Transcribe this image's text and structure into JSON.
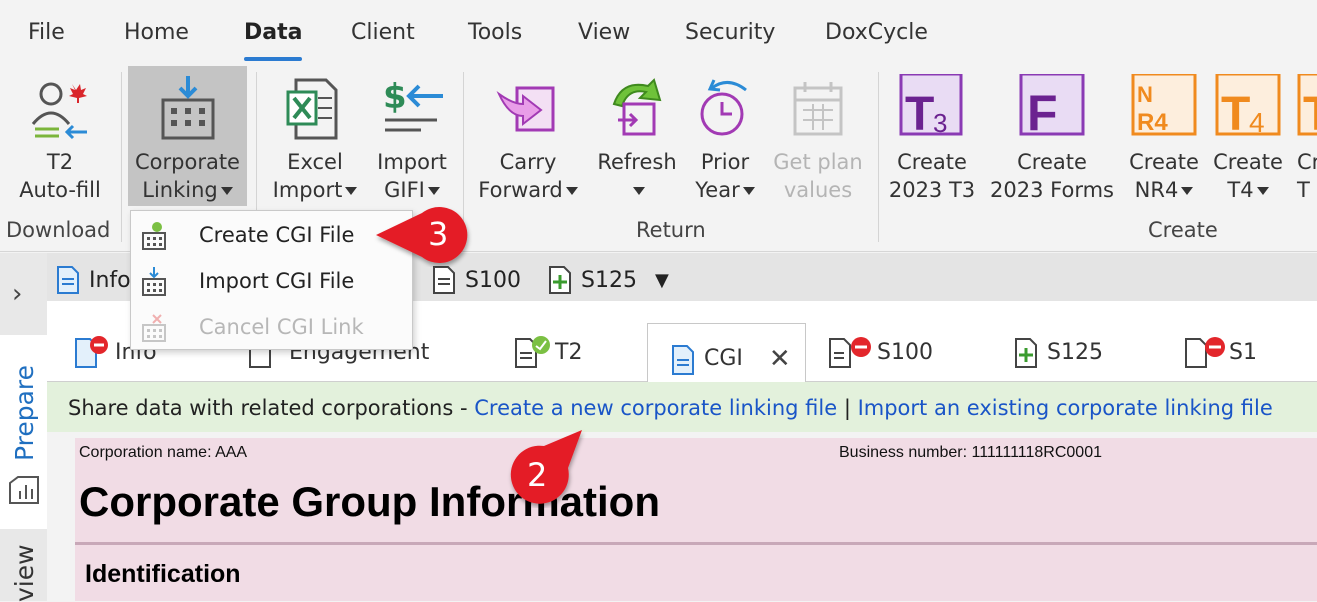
{
  "menu": {
    "tabs": [
      {
        "label": "File"
      },
      {
        "label": "Home"
      },
      {
        "label": "Data"
      },
      {
        "label": "Client"
      },
      {
        "label": "Tools"
      },
      {
        "label": "View"
      },
      {
        "label": "Security"
      },
      {
        "label": "DoxCycle"
      }
    ],
    "active": "Data"
  },
  "ribbon": {
    "buttons": [
      {
        "line1": "T2",
        "line2": "Auto-fill",
        "icon": "t2-autofill-icon"
      },
      {
        "line1": "Corporate",
        "line2": "Linking",
        "icon": "corporate-linking-icon"
      },
      {
        "line1": "Excel",
        "line2": "Import",
        "icon": "excel-icon"
      },
      {
        "line1": "Import",
        "line2": "GIFI",
        "icon": "gifi-import-icon"
      },
      {
        "line1": "Carry",
        "line2": "Forward",
        "icon": "carry-forward-icon"
      },
      {
        "line1": "Refresh",
        "line2": "",
        "icon": "refresh-icon"
      },
      {
        "line1": "Prior",
        "line2": "Year",
        "icon": "prior-year-icon"
      },
      {
        "line1": "Get plan",
        "line2": "values",
        "icon": "calendar-icon"
      },
      {
        "line1": "Create",
        "line2": "2023 T3",
        "icon": "t3-icon"
      },
      {
        "line1": "Create",
        "line2": "2023 Forms",
        "icon": "forms-icon"
      },
      {
        "line1": "Create",
        "line2": "NR4",
        "icon": "nr4-icon"
      },
      {
        "line1": "Create",
        "line2": "T4",
        "icon": "t4-icon"
      },
      {
        "line1": "Cr",
        "line2": "T",
        "icon": "t-icon"
      }
    ],
    "groups": {
      "download": "Download",
      "return": "Return",
      "create": "Create"
    }
  },
  "dropdown": {
    "items": [
      {
        "label": "Create CGI File"
      },
      {
        "label": "Import CGI File"
      },
      {
        "label": "Cancel CGI Link"
      }
    ]
  },
  "docbar": {
    "info": "Info",
    "s100": "S100",
    "s125": "S125"
  },
  "tabs": [
    {
      "label": "Info"
    },
    {
      "label": "Engagement"
    },
    {
      "label": "T2"
    },
    {
      "label": "CGI"
    },
    {
      "label": "S100"
    },
    {
      "label": "S125"
    },
    {
      "label": "S1"
    }
  ],
  "side": {
    "prepare": "Prepare",
    "review": "view"
  },
  "sharebar": {
    "prefix": "Share data with related corporations - ",
    "create_link": "Create a new corporate linking file",
    "separator": " | ",
    "import_link": "Import an existing corporate linking file"
  },
  "form": {
    "corp_name": "Corporation name: AAA",
    "business_number": "Business number: 111111118RC0001",
    "title": "Corporate Group Information",
    "section": "Identification"
  },
  "callouts": {
    "two": "2",
    "three": "3"
  },
  "colors": {
    "accent": "#2b7bd1",
    "link": "#1a55c7",
    "callout": "#e41e26",
    "share_bg": "#e3f1dc",
    "form_bg": "#f1dce5"
  }
}
